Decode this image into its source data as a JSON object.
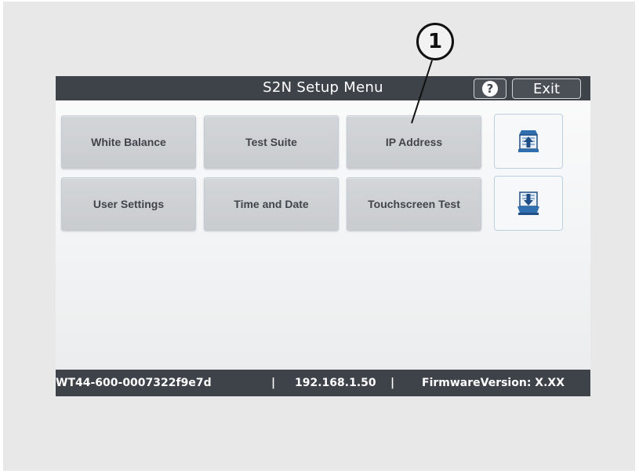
{
  "header": {
    "title": "S2N Setup Menu",
    "help_label": "?",
    "exit_label": "Exit"
  },
  "callout": {
    "label": "1"
  },
  "menu": {
    "buttons": [
      {
        "label": "White Balance"
      },
      {
        "label": "Test Suite"
      },
      {
        "label": "IP Address"
      },
      {
        "label": "User Settings"
      },
      {
        "label": "Time and Date"
      },
      {
        "label": "Touchscreen Test"
      }
    ],
    "side_icons": [
      "tray-upload-icon",
      "tray-download-icon"
    ]
  },
  "status": {
    "device_id": "WT44-600-0007322f9e7d",
    "separator": "|",
    "ip": "192.168.1.50",
    "firmware": "FirmwareVersion: X.XX"
  },
  "colors": {
    "bar": "#3d4349",
    "button": "#cfd2d5",
    "button_text": "#3f454b",
    "icon_blue": "#2f6fb0"
  }
}
